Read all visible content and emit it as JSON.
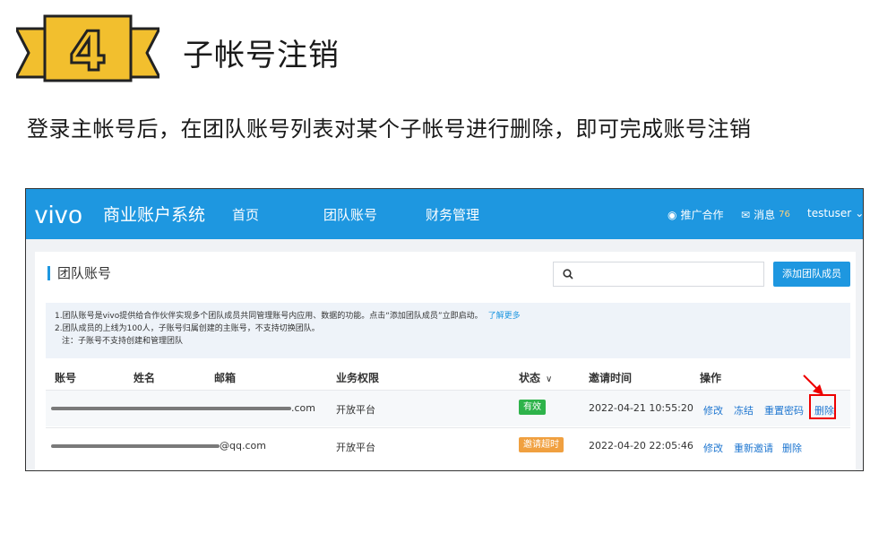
{
  "step_number": "4",
  "page_title": "子帐号注销",
  "subtitle": "登录主帐号后，在团队账号列表对某个子帐号进行删除，即可完成账号注销",
  "app": {
    "logo": "vivo",
    "system_name": "商业账户系统",
    "nav": [
      "首页",
      "团队账号",
      "财务管理"
    ],
    "promo": "推广合作",
    "messages": "消息",
    "message_count": "76",
    "user": "testuser"
  },
  "panel": {
    "title": "团队账号",
    "search_placeholder": "",
    "add_button": "添加团队成员",
    "notice_lines": [
      "1.团队账号是vivo提供给合作伙伴实现多个团队成员共同管理账号内应用、数据的功能。点击“添加团队成员”立即启动。",
      "2.团队成员的上线为100人，子账号归属创建的主账号，不支持切换团队。",
      "注：子账号不支持创建和管理团队"
    ],
    "learn_more": "了解更多"
  },
  "table": {
    "headers": [
      "账号",
      "姓名",
      "邮箱",
      "业务权限",
      "状态",
      "邀请时间",
      "操作"
    ],
    "rows": [
      {
        "email_suffix": ".com",
        "permission": "开放平台",
        "status": "有效",
        "invite_time": "2022-04-21 10:55:20",
        "actions": [
          "修改",
          "冻结",
          "重置密码",
          "删除"
        ]
      },
      {
        "email_suffix": "@qq.com",
        "permission": "开放平台",
        "status": "邀请超时",
        "invite_time": "2022-04-20 22:05:46",
        "actions": [
          "修改",
          "重新邀请",
          "删除"
        ]
      }
    ]
  },
  "colors": {
    "brand": "#1e97e0",
    "badge": "#f2bf2e",
    "active": "#2eb34a",
    "timeout": "#f0a040",
    "highlight": "#e00000"
  }
}
